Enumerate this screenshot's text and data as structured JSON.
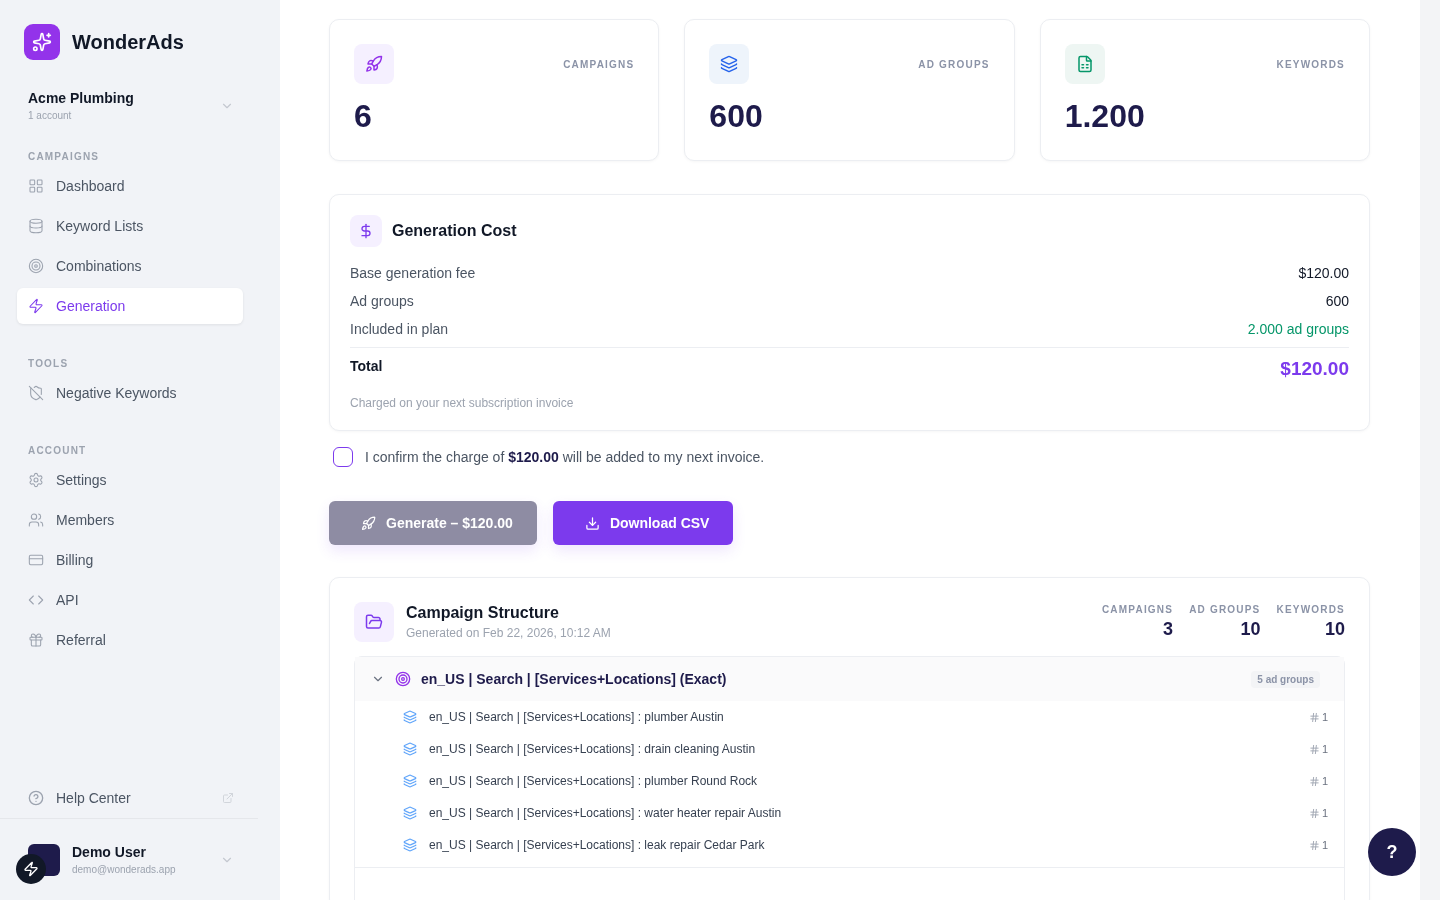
{
  "brand": {
    "name": "WonderAds"
  },
  "workspace": {
    "name": "Acme Plumbing",
    "sub": "1 account"
  },
  "sidebar": {
    "sections": [
      {
        "title": "CAMPAIGNS",
        "items": [
          {
            "label": "Dashboard",
            "selected": false
          },
          {
            "label": "Keyword Lists",
            "selected": false
          },
          {
            "label": "Combinations",
            "selected": false
          },
          {
            "label": "Generation",
            "selected": true
          }
        ]
      },
      {
        "title": "TOOLS",
        "items": [
          {
            "label": "Negative Keywords",
            "selected": false
          }
        ]
      },
      {
        "title": "ACCOUNT",
        "items": [
          {
            "label": "Settings",
            "selected": false
          },
          {
            "label": "Members",
            "selected": false
          },
          {
            "label": "Billing",
            "selected": false
          },
          {
            "label": "API",
            "selected": false
          },
          {
            "label": "Referral",
            "selected": false
          }
        ]
      }
    ],
    "help": "Help Center"
  },
  "user": {
    "name": "Demo User",
    "email": "demo@wonderads.app"
  },
  "stats": [
    {
      "label": "CAMPAIGNS",
      "value": "6"
    },
    {
      "label": "AD GROUPS",
      "value": "600"
    },
    {
      "label": "KEYWORDS",
      "value": "1.200"
    }
  ],
  "cost": {
    "title": "Generation Cost",
    "rows": [
      {
        "label": "Base generation fee",
        "value": "$120.00",
        "kind": "plain"
      },
      {
        "label": "Ad groups",
        "value": "600",
        "kind": "plain"
      },
      {
        "label": "Included in plan",
        "value": "2.000 ad groups",
        "kind": "included"
      }
    ],
    "total_label": "Total",
    "total": "$120.00",
    "note": "Charged on your next subscription invoice"
  },
  "confirm": {
    "text": "I confirm the charge of **$120.00** will be added to my next invoice.",
    "checked": false
  },
  "actions": [
    {
      "label": "Generate – $120.00",
      "kind": "generate",
      "disabled": true
    },
    {
      "label": "Download CSV",
      "kind": "download",
      "disabled": false
    }
  ],
  "structure": {
    "title": "Campaign Structure",
    "subtitle": "Generated on Feb 22, 2026, 10:12 AM",
    "stats": [
      {
        "label": "CAMPAIGNS",
        "value": "3"
      },
      {
        "label": "AD GROUPS",
        "value": "10"
      },
      {
        "label": "KEYWORDS",
        "value": "10"
      }
    ],
    "campaigns": [
      {
        "name": "en_US | Search | [Services+Locations] (Exact)",
        "count": "5 ad groups",
        "expanded": true,
        "children": [
          {
            "name": "en_US | Search | [Services+Locations] : plumber Austin",
            "keywords": "1"
          },
          {
            "name": "en_US | Search | [Services+Locations] : drain cleaning Austin",
            "keywords": "1"
          },
          {
            "name": "en_US | Search | [Services+Locations] : plumber Round Rock",
            "keywords": "1"
          },
          {
            "name": "en_US | Search | [Services+Locations] : water heater repair Austin",
            "keywords": "1"
          },
          {
            "name": "en_US | Search | [Services+Locations] : leak repair Cedar Park",
            "keywords": "1"
          }
        ]
      }
    ]
  },
  "help_button": {
    "label": "?"
  }
}
